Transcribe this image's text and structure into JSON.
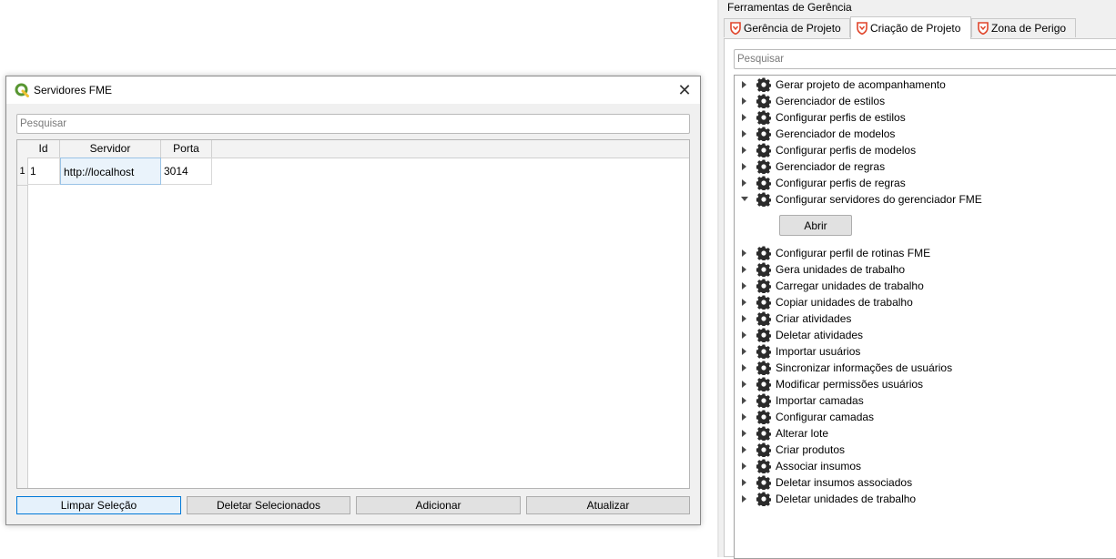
{
  "dialog": {
    "title": "Servidores FME",
    "close_symbol": "✕",
    "search_placeholder": "Pesquisar",
    "columns": [
      "Id",
      "Servidor",
      "Porta"
    ],
    "rows": [
      {
        "row_number": "1",
        "id": "1",
        "servidor": "http://localhost",
        "porta": "3014"
      }
    ],
    "buttons": {
      "clear": "Limpar Seleção",
      "delete": "Deletar Selecionados",
      "add": "Adicionar",
      "refresh": "Atualizar"
    }
  },
  "dock": {
    "title": "Ferramentas de Gerência",
    "tabs": [
      "Gerência de Projeto",
      "Criação de Projeto",
      "Zona de Perigo"
    ],
    "active_tab": 1,
    "search_placeholder": "Pesquisar",
    "open_button": "Abrir",
    "items": [
      "Gerar projeto de acompanhamento",
      "Gerenciador de estilos",
      "Configurar perfis de estilos",
      "Gerenciador de modelos",
      "Configurar perfis de modelos",
      "Gerenciador de regras",
      "Configurar perfis de regras",
      "Configurar servidores do gerenciador FME",
      "Configurar perfil de rotinas FME",
      "Gera unidades de trabalho",
      "Carregar unidades de trabalho",
      "Copiar unidades de trabalho",
      "Criar atividades",
      "Deletar atividades",
      "Importar usuários",
      "Sincronizar informações de usuários",
      "Modificar permissões usuários",
      "Importar camadas",
      "Configurar camadas",
      "Alterar lote",
      "Criar produtos",
      "Associar insumos",
      "Deletar insumos associados",
      "Deletar unidades de trabalho"
    ],
    "expanded_item": 7
  },
  "icons": {
    "app": "qgis-icon",
    "tab": "shield-icon",
    "item": "gear-icon"
  },
  "colors": {
    "accent": "#0078d7",
    "tab_icon": "#e0452b",
    "qgis_green": "#589632"
  }
}
